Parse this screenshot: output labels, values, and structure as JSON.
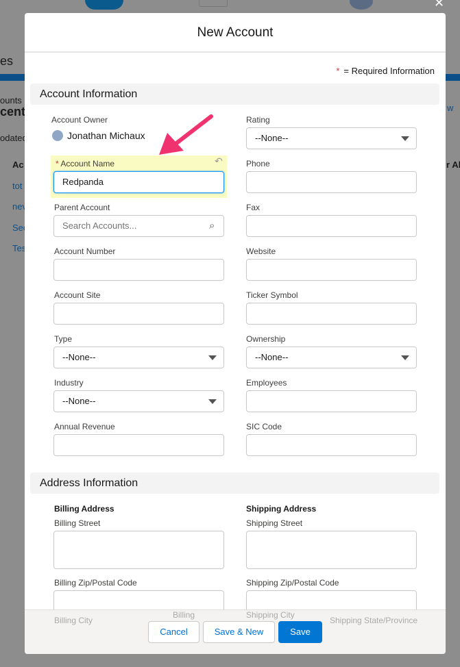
{
  "background": {
    "fragments": [
      "es",
      "ounts",
      "cent",
      "odated",
      "Ac",
      "tot",
      "nev",
      "Sec",
      "Tes",
      "w",
      "r Ali"
    ]
  },
  "modal": {
    "title": "New Account",
    "required_note": "= Required Information",
    "required_mark": "*"
  },
  "sections": {
    "account": "Account Information",
    "address": "Address Information"
  },
  "fields": {
    "owner_label": "Account Owner",
    "owner_value": "Jonathan Michaux",
    "account_name_label": "Account Name",
    "account_name_value": "Redpanda",
    "parent_label": "Parent Account",
    "parent_placeholder": "Search Accounts...",
    "account_number_label": "Account Number",
    "account_site_label": "Account Site",
    "type_label": "Type",
    "type_value": "--None--",
    "industry_label": "Industry",
    "industry_value": "--None--",
    "annual_revenue_label": "Annual Revenue",
    "rating_label": "Rating",
    "rating_value": "--None--",
    "phone_label": "Phone",
    "fax_label": "Fax",
    "website_label": "Website",
    "ticker_label": "Ticker Symbol",
    "ownership_label": "Ownership",
    "ownership_value": "--None--",
    "employees_label": "Employees",
    "sic_label": "SIC Code"
  },
  "address": {
    "billing_heading": "Billing Address",
    "shipping_heading": "Shipping Address",
    "billing_street": "Billing Street",
    "shipping_street": "Shipping Street",
    "billing_zip": "Billing Zip/Postal Code",
    "shipping_zip": "Shipping Zip/Postal Code",
    "billing_city": "Billing City",
    "billing_state": "Billing",
    "shipping_city": "Shipping City",
    "shipping_state": "Shipping State/Province"
  },
  "footer": {
    "cancel": "Cancel",
    "save_new": "Save & New",
    "save": "Save"
  },
  "colors": {
    "brand": "#0070d2",
    "highlight": "#fafbc3",
    "arrow": "#f0326e",
    "required": "#c23934"
  }
}
